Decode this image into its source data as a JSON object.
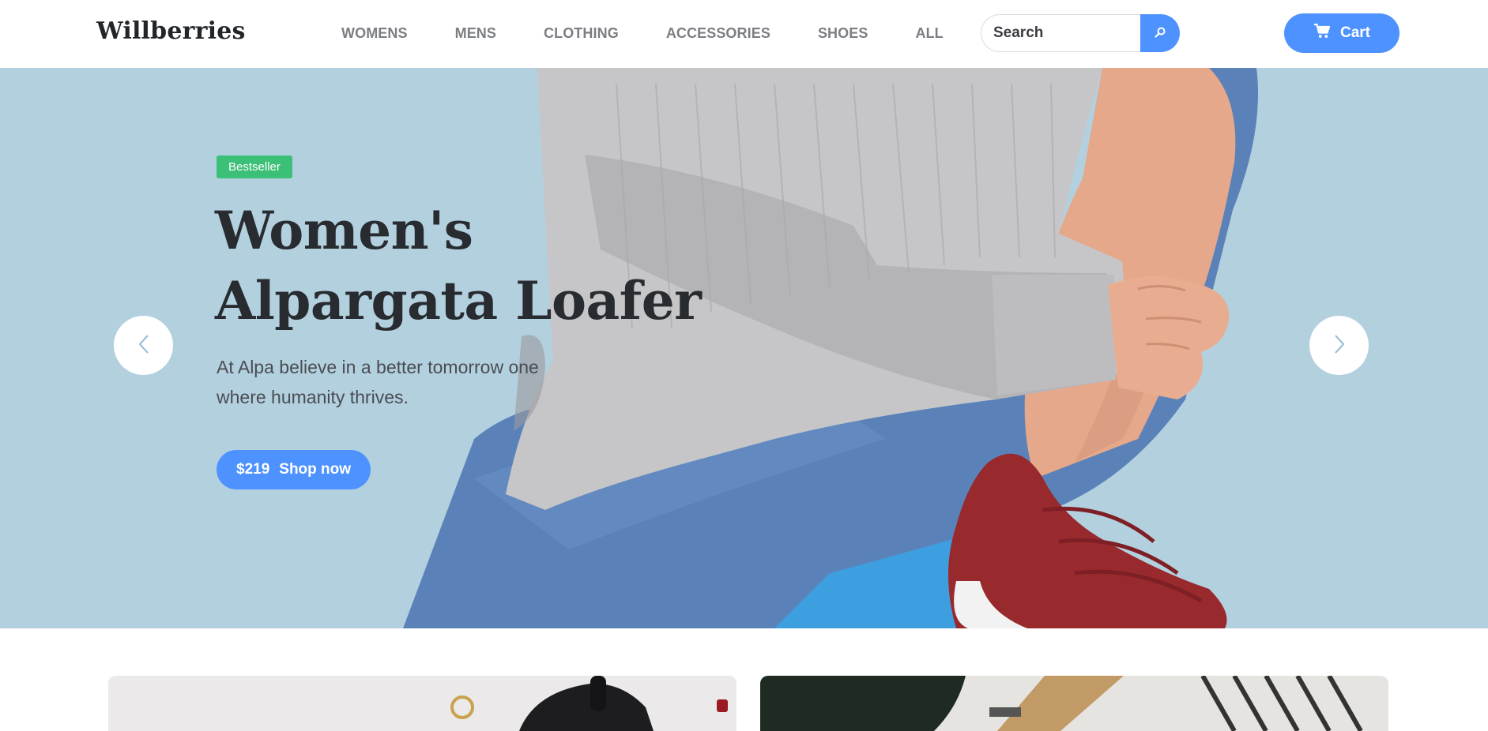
{
  "header": {
    "logo": "Willberries",
    "nav": [
      "WOMENS",
      "MENS",
      "CLOTHING",
      "ACCESSORIES",
      "SHOES",
      "ALL"
    ],
    "search": {
      "placeholder": "Search",
      "icon": "search-icon"
    },
    "cart": {
      "label": "Cart",
      "icon": "cart-icon"
    }
  },
  "hero": {
    "badge": "Bestseller",
    "title_line1": "Women's",
    "title_line2": "Alpargata Loafer",
    "description": "At Alpa believe in a better tomorrow one where humanity thrives.",
    "price": "$219",
    "cta": "Shop now",
    "prev_icon": "chevron-left-icon",
    "next_icon": "chevron-right-icon",
    "background_color": "#b3d0df"
  },
  "colors": {
    "accent": "#4d92ff",
    "badge": "#3cbf76",
    "nav_text": "#7b7e82",
    "title_text": "#282b2f"
  }
}
